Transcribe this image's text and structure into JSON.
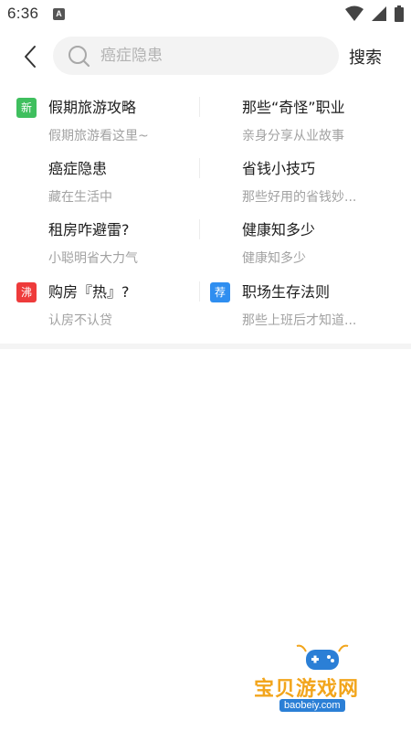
{
  "status_bar": {
    "time": "6:36",
    "app_icon_letter": "A",
    "icons": [
      "wifi-icon",
      "signal-icon",
      "battery-icon"
    ]
  },
  "top_bar": {
    "back_icon": "chevron-left-icon",
    "search_icon": "search-icon",
    "search_placeholder": "癌症隐患",
    "search_value": "",
    "search_button_label": "搜索"
  },
  "hot_list": {
    "items": [
      {
        "title": "假期旅游攻略",
        "subtitle": "假期旅游看这里~",
        "badge": "新",
        "badge_color": "#3fbf5e"
      },
      {
        "title": "那些“奇怪”职业",
        "subtitle": "亲身分享从业故事",
        "badge": "",
        "badge_color": ""
      },
      {
        "title": "癌症隐患",
        "subtitle": "藏在生活中",
        "badge": "",
        "badge_color": ""
      },
      {
        "title": "省钱小技巧",
        "subtitle": "那些好用的省钱妙...",
        "badge": "",
        "badge_color": ""
      },
      {
        "title": "租房咋避雷?",
        "subtitle": "小聪明省大力气",
        "badge": "",
        "badge_color": ""
      },
      {
        "title": "健康知多少",
        "subtitle": "健康知多少",
        "badge": "",
        "badge_color": ""
      },
      {
        "title": "购房『热』?",
        "subtitle": "认房不认贷",
        "badge": "沸",
        "badge_color": "#ee3b3b"
      },
      {
        "title": "职场生存法则",
        "subtitle": "那些上班后才知道...",
        "badge": "荐",
        "badge_color": "#2f8ef0"
      }
    ]
  },
  "watermark": {
    "text": "宝贝游戏网",
    "url": "baobeiy.com"
  }
}
